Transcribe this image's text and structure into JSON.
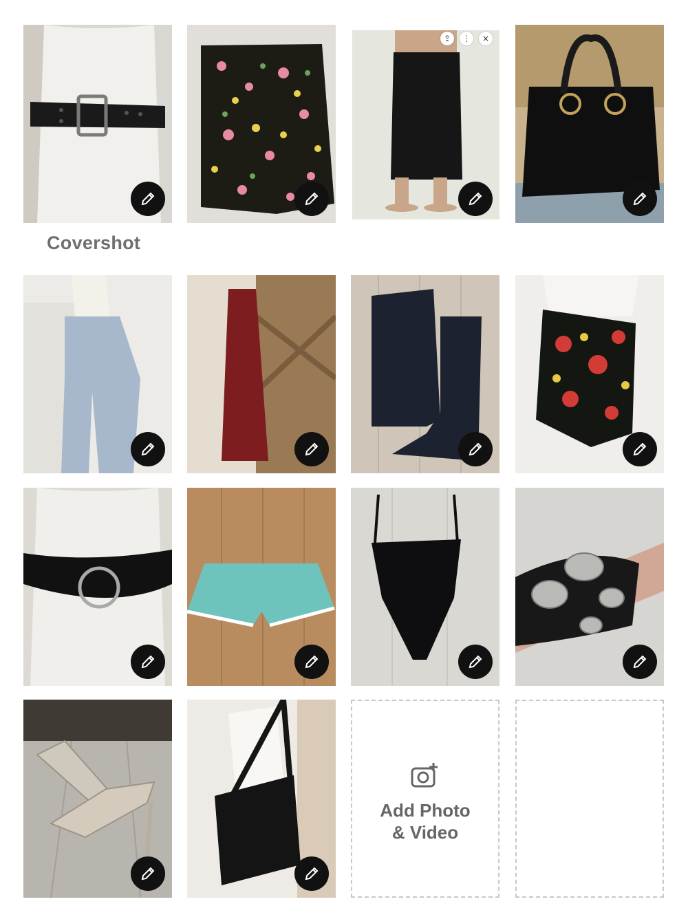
{
  "covershot_label": "Covershot",
  "add_tile": {
    "label_line1": "Add Photo",
    "label_line2": "& Video",
    "icon": "camera-plus-icon"
  },
  "edit_icon": "pencil-icon",
  "photos": [
    {
      "name": "black-belt-mannequin"
    },
    {
      "name": "floral-wrap-skirt"
    },
    {
      "name": "black-knit-midi-skirt"
    },
    {
      "name": "black-leather-handbag"
    },
    {
      "name": "wide-leg-jeans"
    },
    {
      "name": "red-velvet-slip-dress"
    },
    {
      "name": "black-suede-knee-boots"
    },
    {
      "name": "floral-sarong-wrap"
    },
    {
      "name": "black-ring-belt"
    },
    {
      "name": "aqua-crochet-shorts"
    },
    {
      "name": "black-bodysuit"
    },
    {
      "name": "silver-concho-belt"
    },
    {
      "name": "metallic-strappy-heels"
    },
    {
      "name": "black-crochet-crossbody-bag"
    }
  ]
}
